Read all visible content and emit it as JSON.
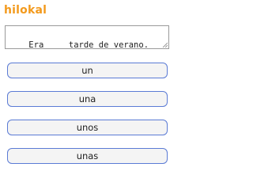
{
  "header": {
    "logo_text": "hilokal"
  },
  "exercise": {
    "sentence": "Era ___ tarde de verano."
  },
  "options": [
    {
      "label": "un"
    },
    {
      "label": "una"
    },
    {
      "label": "unos"
    },
    {
      "label": "unas"
    }
  ],
  "colors": {
    "brand": "#f39a1d",
    "option_border": "#5b7bd5",
    "option_background": "#f4f4f4"
  }
}
